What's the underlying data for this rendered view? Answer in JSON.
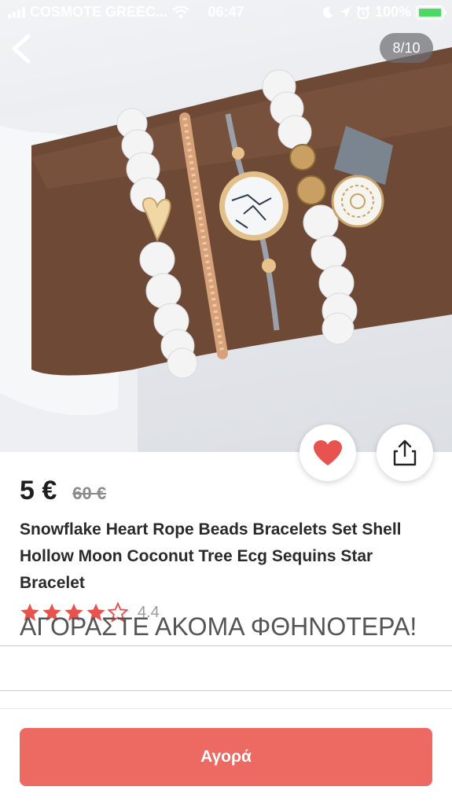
{
  "status_bar": {
    "carrier": "COSMOTE GREEC...",
    "time": "06:47",
    "battery": "100%"
  },
  "gallery": {
    "counter": "8/10"
  },
  "product": {
    "price": "5 €",
    "old_price": "60 €",
    "title": "Snowflake Heart Rope Beads Bracelets Set Shell Hollow Moon Coconut Tree Ecg Sequins Star Bracelet",
    "rating": 4.4,
    "rating_label": "4.4"
  },
  "promo": {
    "text": "ΑΓΟΡΑΣΤΕ ΑΚΟΜΑ ΦΘΗΝΟΤΕΡΑ!"
  },
  "actions": {
    "buy_label": "Αγορά"
  },
  "colors": {
    "accent": "#ed6a62",
    "heart": "#e9534f",
    "star": "#e8534f"
  },
  "icons": [
    "back-icon",
    "heart-icon",
    "share-icon",
    "star-icon",
    "wifi-icon",
    "moon-icon",
    "location-icon",
    "alarm-icon",
    "battery-icon"
  ]
}
